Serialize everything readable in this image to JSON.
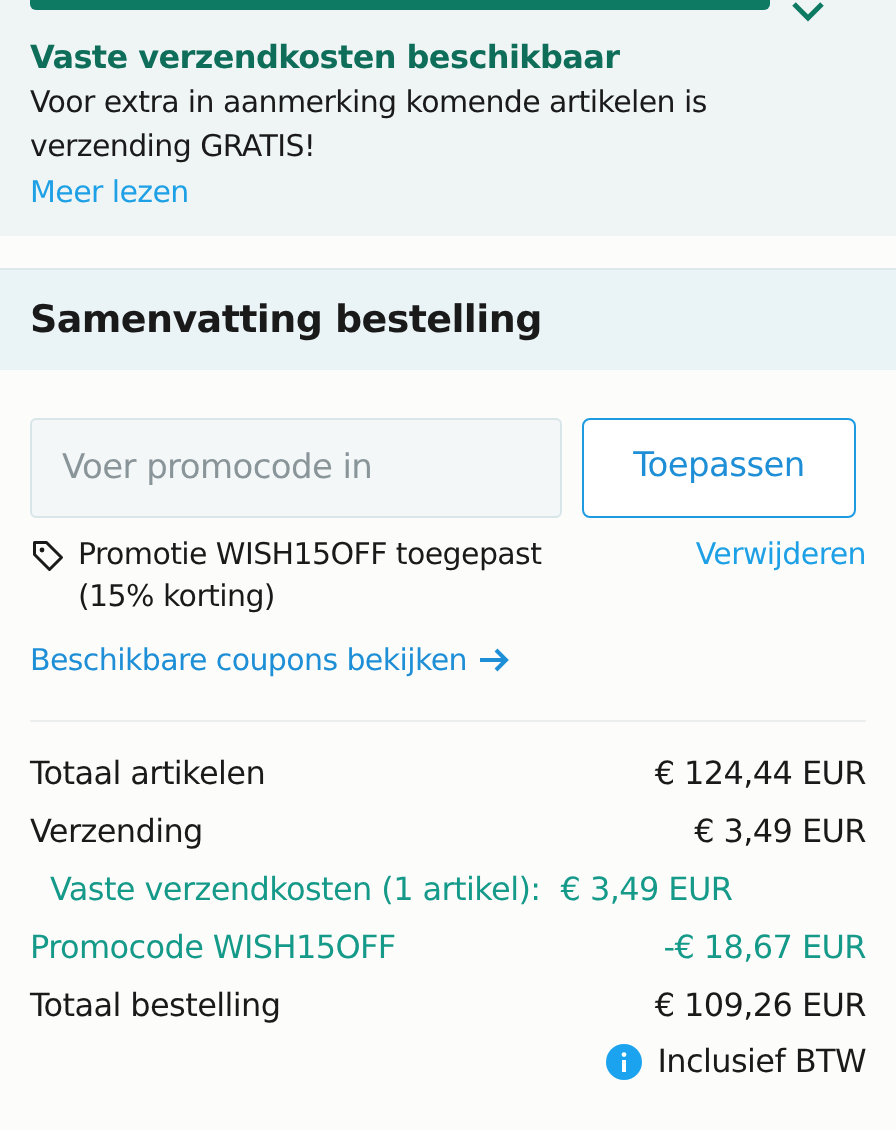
{
  "shipping_notice": {
    "level": 1,
    "title": "Vaste verzendkosten beschikbaar",
    "text": "Voor extra in aanmerking komende artikelen is verzending GRATIS!",
    "link": "Meer lezen"
  },
  "summary": {
    "title": "Samenvatting bestelling",
    "promo_field": {
      "placeholder": "Voer promocode in"
    },
    "apply_button": "Toepassen",
    "applied_promo": {
      "text": "Promotie WISH15OFF toegepast (15% korting)",
      "remove": "Verwijderen"
    },
    "coupons_link": "Beschikbare coupons bekijken",
    "rows": [
      {
        "kind": "normal",
        "label": "Totaal artikelen",
        "value": "€ 124,44 EUR"
      },
      {
        "kind": "normal",
        "label": "Verzending",
        "value": "€ 3,49 EUR"
      },
      {
        "kind": "sub",
        "label": "Vaste verzendkosten (1 artikel):",
        "value": "€ 3,49 EUR"
      },
      {
        "kind": "discount",
        "label": "Promocode WISH15OFF",
        "value": "-€ 18,67 EUR"
      },
      {
        "kind": "normal",
        "label": "Totaal bestelling",
        "value": "€ 109,26 EUR"
      }
    ],
    "tax_note": "Inclusief BTW"
  }
}
